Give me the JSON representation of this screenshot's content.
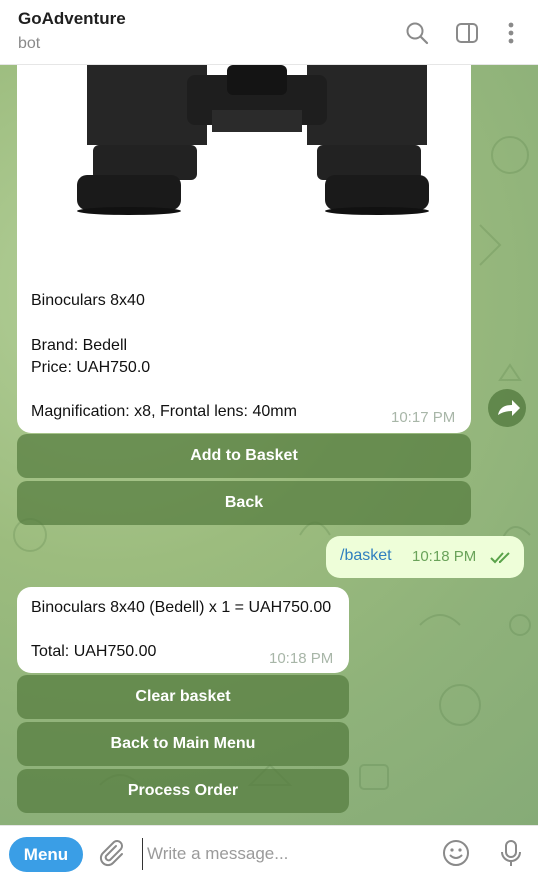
{
  "header": {
    "title": "GoAdventure",
    "subtitle": "bot",
    "icons": [
      "search-icon",
      "sidebar-panel-icon",
      "more-vertical-icon"
    ]
  },
  "product_message": {
    "name": "Binoculars 8x40",
    "brand": "Brand: Bedell",
    "price": "Price: UAH750.0",
    "specs": "Magnification: x8, Frontal lens: 40mm",
    "time": "10:17 PM",
    "buttons": [
      "Add to Basket",
      "Back"
    ]
  },
  "user_message": {
    "text": "/basket",
    "time": "10:18 PM",
    "status_icon": "double-check-icon"
  },
  "basket_message": {
    "line": "Binoculars 8x40 (Bedell) x 1 = UAH750.00",
    "total": "Total: UAH750.00",
    "time": "10:18 PM",
    "buttons": [
      "Clear basket",
      "Back to Main Menu",
      "Process Order"
    ]
  },
  "footer": {
    "menu_label": "Menu",
    "placeholder": "Write a message...",
    "icons": [
      "attach-icon",
      "emoji-icon",
      "microphone-icon"
    ]
  },
  "colors": {
    "accent": "#3a9ee6",
    "out_bubble": "#eefed9",
    "keyboard_button": "#5a7c44"
  }
}
